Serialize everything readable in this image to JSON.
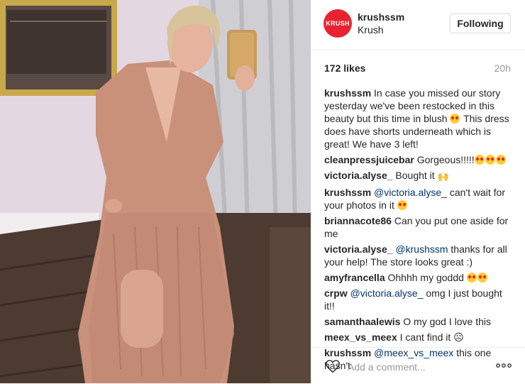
{
  "post": {
    "avatar_text": "KRUSH",
    "username": "krushssm",
    "full_name": "Krush",
    "follow_label": "Following",
    "likes": "172 likes",
    "time": "20h",
    "comment_placeholder": "Add a comment..."
  },
  "comments": [
    {
      "user": "krushssm",
      "text_a": "In case you missed our story yesterday we've been restocked in this beauty but this time in blush",
      "text_b": "This dress does have shorts underneath which is great! We have 3 left!"
    },
    {
      "user": "cleanpressjuicebar",
      "text": "Gorgeous!!!!!"
    },
    {
      "user": "victoria.alyse_",
      "text": "Bought it"
    },
    {
      "user": "krushssm",
      "mention": "@victoria.alyse_",
      "text": "can't wait for your photos in it"
    },
    {
      "user": "briannacote86",
      "text": "Can you put one aside for me"
    },
    {
      "user": "victoria.alyse_",
      "mention": "@krushssm",
      "text": "thanks for all your help! The store looks great :)"
    },
    {
      "user": "amyfrancella",
      "text": "Ohhhh my goddd"
    },
    {
      "user": "crpw",
      "mention": "@victoria.alyse_",
      "text": "omg I just bought it!!"
    },
    {
      "user": "samanthaalewis",
      "text": "O my god I love this"
    },
    {
      "user": "meex_vs_meex",
      "text": "I cant find it ☹"
    },
    {
      "user": "krushssm",
      "mention": "@meex_vs_meex",
      "text": "this one hasn't"
    }
  ],
  "icons": {
    "avatar": "krush-logo",
    "like": "heart-outline-icon",
    "more": "ellipsis-icon",
    "emoji_heart_eyes": "heart-eyes-emoji",
    "emoji_raised_hands": "raised-hands-emoji"
  },
  "colors": {
    "brand_red": "#e8232f",
    "text": "#262626",
    "muted": "#999999",
    "mention": "#003569"
  }
}
